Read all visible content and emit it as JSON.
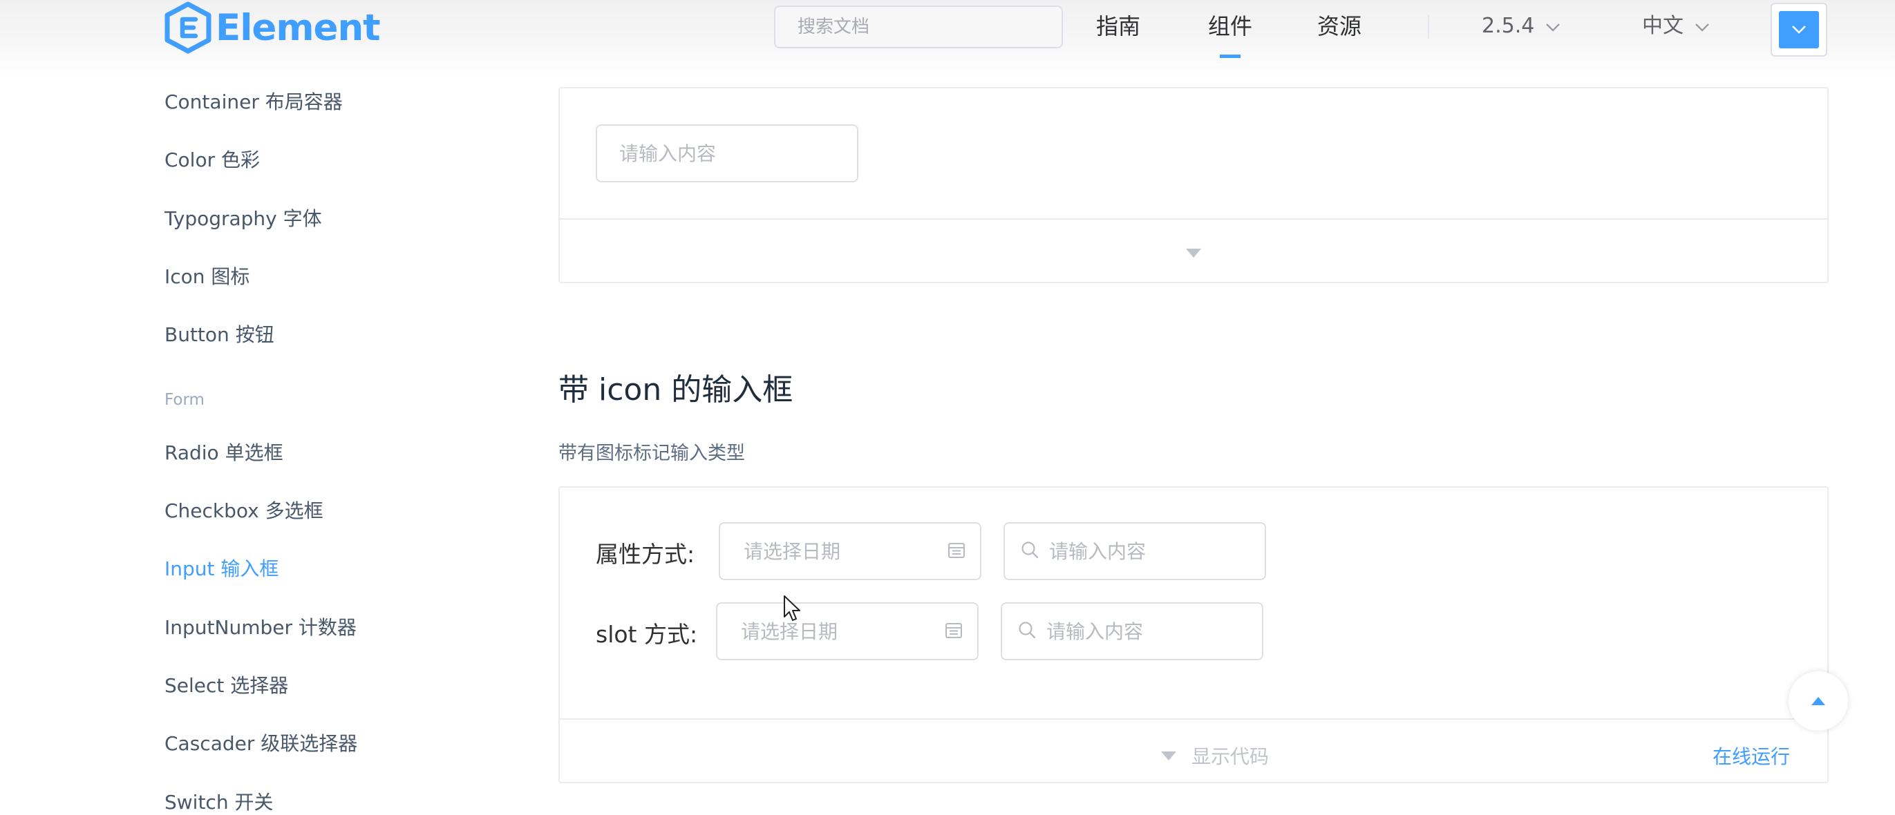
{
  "header": {
    "logo_text": "Element",
    "search_placeholder": "搜索文档",
    "nav": {
      "guide": "指南",
      "component": "组件",
      "resource": "资源"
    },
    "version": "2.5.4",
    "language": "中文"
  },
  "sidebar": {
    "items": [
      {
        "label": "Container 布局容器"
      },
      {
        "label": "Color 色彩"
      },
      {
        "label": "Typography 字体"
      },
      {
        "label": "Icon 图标"
      },
      {
        "label": "Button 按钮"
      }
    ],
    "group_form": "Form",
    "form_items": [
      {
        "label": "Radio 单选框"
      },
      {
        "label": "Checkbox 多选框"
      },
      {
        "label": "Input 输入框"
      },
      {
        "label": "InputNumber 计数器"
      },
      {
        "label": "Select 选择器"
      },
      {
        "label": "Cascader 级联选择器"
      },
      {
        "label": "Switch 开关"
      }
    ]
  },
  "demo1": {
    "input_placeholder": "请输入内容"
  },
  "section": {
    "title": "带 icon 的输入框",
    "description": "带有图标标记输入类型"
  },
  "demo2": {
    "row1_label": "属性方式:",
    "row2_label": "slot 方式:",
    "date_placeholder": "请选择日期",
    "input_placeholder": "请输入内容",
    "show_code": "显示代码",
    "run_online": "在线运行"
  },
  "colors": {
    "brand": "#409eff",
    "text_primary": "#303133",
    "sidebar_text": "#48576a",
    "placeholder": "#b7bac1",
    "border": "#dcdfe6"
  }
}
